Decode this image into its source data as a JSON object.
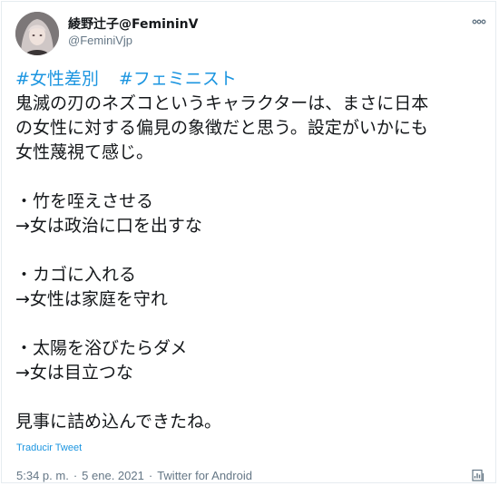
{
  "author": {
    "display_name": "綾野辻子@FemininV",
    "handle": "@FeminiVjp"
  },
  "tweet": {
    "hashtags": [
      "#女性差別",
      "#フェミニスト"
    ],
    "intro_lines": [
      "鬼滅の刃のネズコというキャラクターは、まさに日本",
      "の女性に対する偏見の象徴だと思う。設定がいかにも",
      "女性蔑視て感じ。"
    ],
    "points": [
      {
        "item": "・竹を咥えさせる",
        "meaning": "→女は政治に口を出すな"
      },
      {
        "item": "・カゴに入れる",
        "meaning": "→女性は家庭を守れ"
      },
      {
        "item": "・太陽を浴びたらダメ",
        "meaning": "→女は目立つな"
      }
    ],
    "closing": "見事に詰め込んできたね。"
  },
  "translate_label": "Traducir Tweet",
  "meta": {
    "time": "5:34 p. m.",
    "date": "5 ene. 2021",
    "source": "Twitter for Android"
  },
  "icons": {
    "more": "more-options-icon",
    "analytics": "analytics-icon"
  },
  "colors": {
    "link": "#1b95e0",
    "text": "#14171a",
    "secondary": "#657786",
    "border": "#e6ecf0"
  }
}
